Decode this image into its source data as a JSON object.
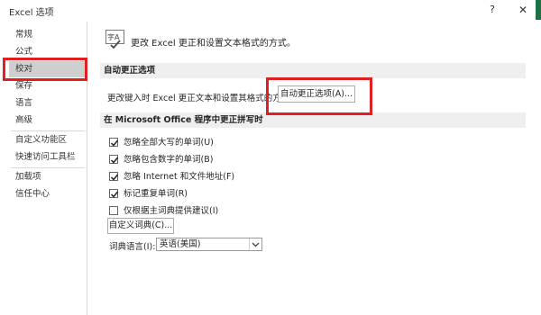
{
  "window": {
    "title": "Excel 选项",
    "help_symbol": "?",
    "close_symbol": "✕",
    "accent_color": "#1e7145"
  },
  "sidebar": {
    "items": [
      {
        "label": "常规"
      },
      {
        "label": "公式"
      },
      {
        "label": "校对",
        "selected": true
      },
      {
        "label": "保存"
      },
      {
        "label": "语言"
      },
      {
        "label": "高级"
      },
      {
        "label": "自定义功能区"
      },
      {
        "label": "快速访问工具栏"
      },
      {
        "label": "加载项"
      },
      {
        "label": "信任中心"
      }
    ]
  },
  "main": {
    "header_icon": "abc-check-icon",
    "header_icon_text": "字A",
    "header_text": "更改 Excel 更正和设置文本格式的方式。",
    "autocorrect": {
      "section_title": "自动更正选项",
      "description": "更改键入时 Excel 更正文本和设置其格式的方式：",
      "button_label": "自动更正选项(A)..."
    },
    "spelling": {
      "section_title": "在 Microsoft Office 程序中更正拼写时",
      "options": [
        {
          "label": "忽略全部大写的单词(U)",
          "checked": true
        },
        {
          "label": "忽略包含数字的单词(B)",
          "checked": true
        },
        {
          "label": "忽略 Internet 和文件地址(F)",
          "checked": true
        },
        {
          "label": "标记重复单词(R)",
          "checked": true
        },
        {
          "label": "仅根据主词典提供建议(I)",
          "checked": false
        }
      ],
      "custom_dict_button": "自定义词典(C)...",
      "dict_language_label": "词典语言(I):",
      "dict_language_value": "英语(美国)"
    }
  },
  "highlight_color": "#e02020"
}
